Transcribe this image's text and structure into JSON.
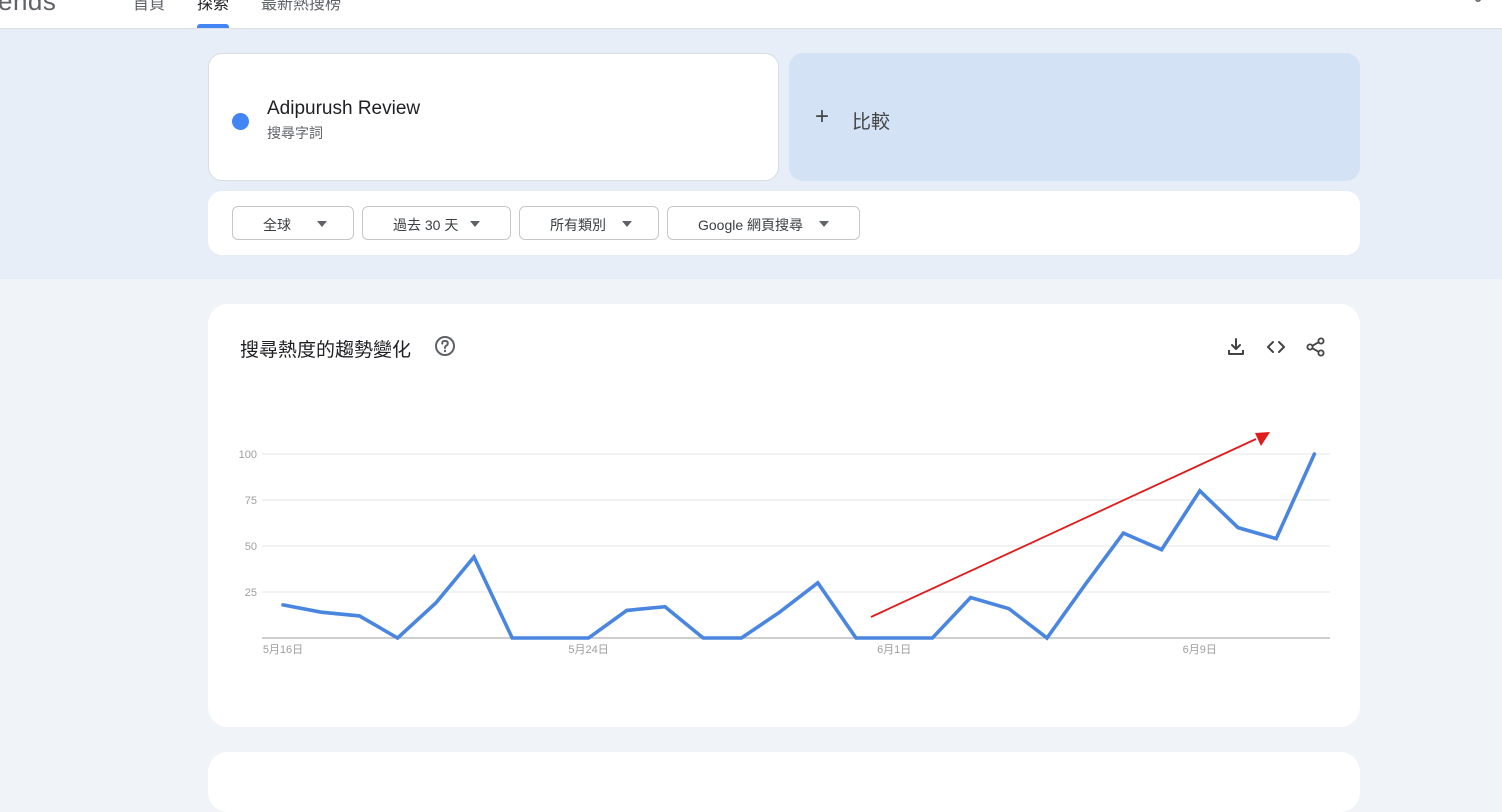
{
  "header": {
    "logo_text": "ends",
    "tabs": [
      {
        "label": "首頁"
      },
      {
        "label": "探索"
      },
      {
        "label": "最新熱搜榜"
      }
    ],
    "share_icon": "share-icon"
  },
  "term": {
    "name": "Adipurush Review",
    "type": "搜尋字詞",
    "color": "#4285f4"
  },
  "compare": {
    "plus": "+",
    "label": "比較"
  },
  "filters": [
    {
      "label": "全球"
    },
    {
      "label": "過去 30 天"
    },
    {
      "label": "所有類別"
    },
    {
      "label": "Google 網頁搜尋"
    }
  ],
  "chart_card": {
    "title": "搜尋熱度的趨勢變化",
    "icons": [
      "help-icon",
      "download-icon",
      "embed-code-icon",
      "share-icon"
    ]
  },
  "chart_data": {
    "type": "line",
    "title": "",
    "xlabel": "",
    "ylabel": "",
    "x_tick_labels": [
      "5月16日",
      "5月24日",
      "6月1日",
      "6月9日"
    ],
    "y_tick_labels": [
      "25",
      "50",
      "75",
      "100"
    ],
    "ylim": [
      0,
      100
    ],
    "grid": true,
    "series": [
      {
        "color": "#4a86e0",
        "x": [
          "5月16日",
          "5月17日",
          "5月18日",
          "5月19日",
          "5月20日",
          "5月21日",
          "5月22日",
          "5月23日",
          "5月24日",
          "5月25日",
          "5月26日",
          "5月27日",
          "5月28日",
          "5月29日",
          "5月30日",
          "5月31日",
          "6月1日",
          "6月2日",
          "6月3日",
          "6月4日",
          "6月5日",
          "6月6日",
          "6月7日",
          "6月8日",
          "6月9日",
          "6月10日",
          "6月11日",
          "6月12日"
        ],
        "values": [
          18,
          14,
          12,
          0,
          19,
          44,
          0,
          0,
          0,
          15,
          17,
          0,
          0,
          14,
          30,
          0,
          0,
          0,
          22,
          16,
          0,
          29,
          57,
          48,
          80,
          60,
          54,
          100
        ]
      }
    ],
    "annotation": {
      "type": "arrow",
      "color": "#e01b1b"
    }
  }
}
